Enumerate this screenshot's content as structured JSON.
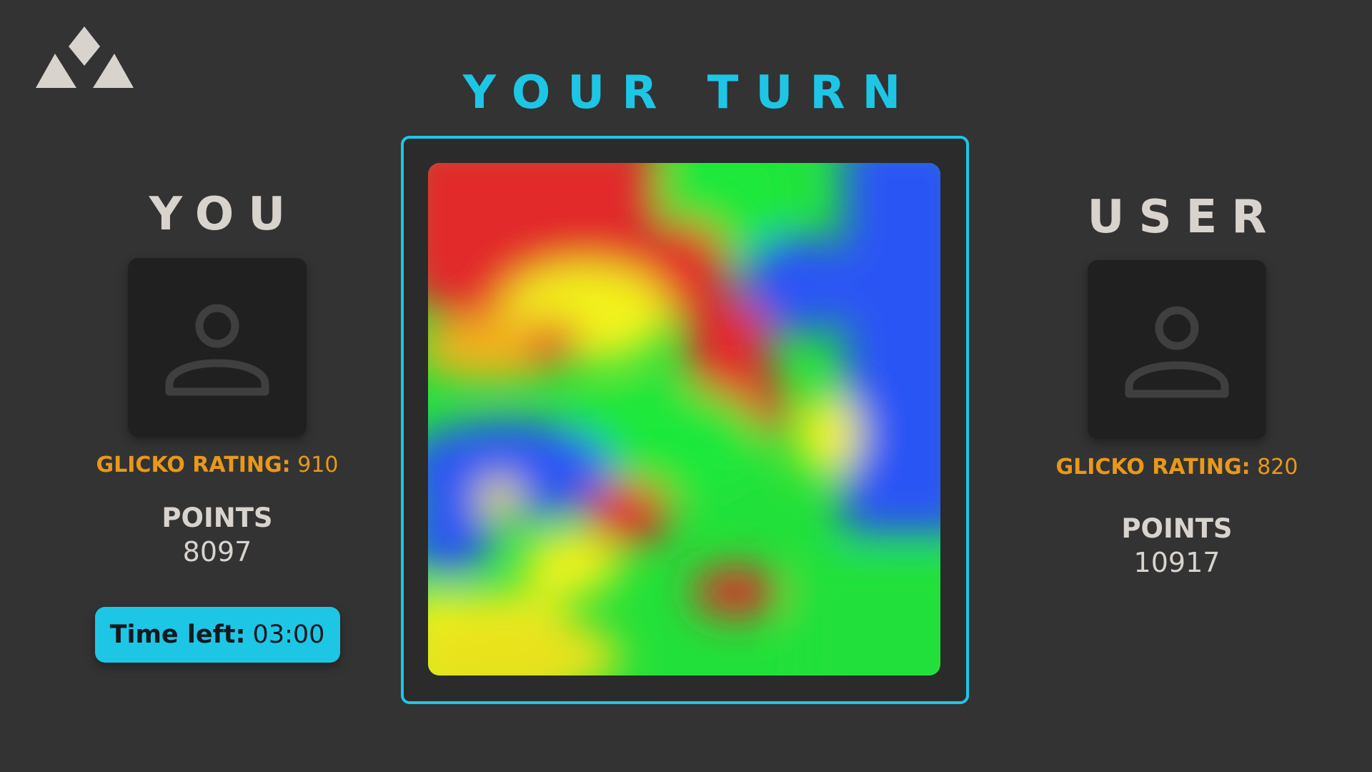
{
  "game": {
    "turn_banner": "YOUR TURN",
    "accent_color": "#1ec6e6",
    "rating_color": "#e8981a",
    "logo_icon": "triforce-mountain-logo"
  },
  "players": {
    "left": {
      "name": "YOU",
      "avatar_icon": "user-avatar-icon",
      "rating_label": "GLICKO RATING:",
      "rating_value": "910",
      "points_label": "POINTS",
      "points_value": "8097",
      "timer_label": "Time left:",
      "timer_value": "03:00"
    },
    "right": {
      "name": "USER",
      "avatar_icon": "user-avatar-icon",
      "rating_label": "GLICKO RATING:",
      "rating_value": "820",
      "points_label": "POINTS",
      "points_value": "10917"
    }
  },
  "board": {
    "type": "blurred-color-heatmap",
    "palette": [
      "#e22a2a",
      "#f2f21a",
      "#1ee83a",
      "#2a55f5"
    ]
  }
}
